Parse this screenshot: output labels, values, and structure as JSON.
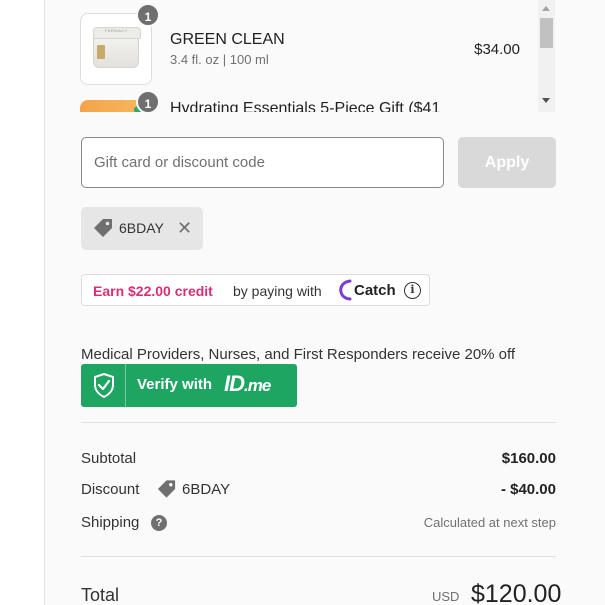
{
  "products": [
    {
      "name": "GREEN CLEAN",
      "variant": "3.4 fl. oz | 100 ml",
      "price": "$34.00",
      "quantity": "1",
      "thumb_text": "FARMACY",
      "thumb_icon": "green-clean-jar-image"
    },
    {
      "name": "Hydrating Essentials 5-Piece Gift ($41",
      "quantity": "1",
      "thumb_icon": "gift-set-image"
    }
  ],
  "discount": {
    "placeholder": "Gift card or discount code",
    "apply_label": "Apply",
    "applied_code": "6BDAY",
    "tag_icon": "tag-icon",
    "remove_icon": "close-icon"
  },
  "catch": {
    "earn_text": "Earn $22.00 credit",
    "by_text": "by paying with",
    "brand": "Catch",
    "info_glyph": "i",
    "brand_color": "#d4307a"
  },
  "idme": {
    "eligibility_text": "Medical Providers, Nurses, and First Responders receive 20% off",
    "verify_label": "Verify with",
    "logo_id": "ID",
    "logo_me": ".me",
    "button_color": "#1ea562"
  },
  "summary": {
    "subtotal_label": "Subtotal",
    "subtotal_value": "$160.00",
    "discount_label": "Discount",
    "discount_code": "6BDAY",
    "discount_value": "- $40.00",
    "shipping_label": "Shipping",
    "shipping_help_glyph": "?",
    "shipping_value": "Calculated at next step",
    "total_label": "Total",
    "currency": "USD",
    "total_value": "$120.00"
  }
}
